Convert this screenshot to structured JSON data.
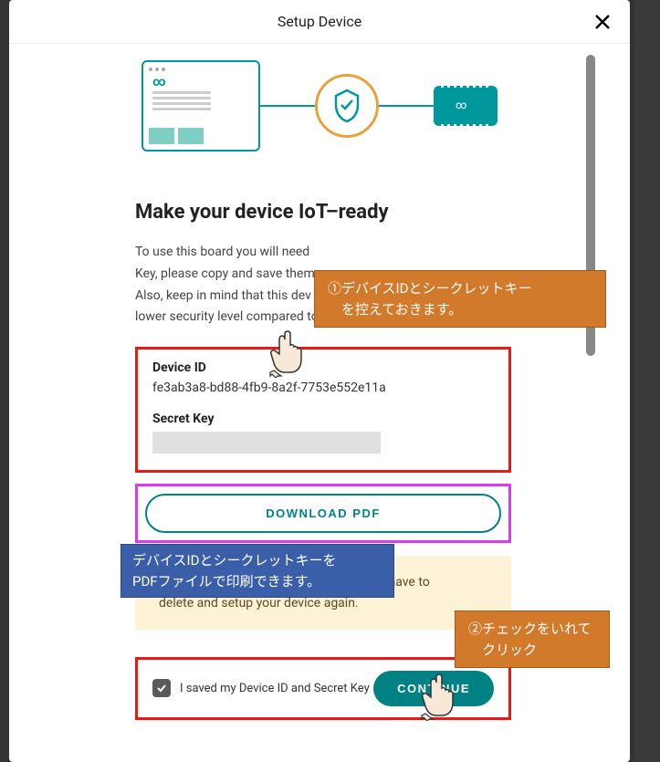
{
  "header": {
    "title": "Setup Device"
  },
  "main": {
    "heading": "Make your device IoT–ready",
    "description_l1": "To use this board you will need",
    "description_l2": "Key, please copy and save them",
    "description_l3": "Also, keep in mind that this dev",
    "description_l4": "lower security level compared to other Arduino devices.",
    "device_id_label": "Device ID",
    "device_id_value": "fe3ab3a8-bd88-4fb9-8a2f-7753e552e11a",
    "secret_key_label": "Secret Key",
    "download_label": "DOWNLOAD PDF",
    "warning_l1": "Please keep it safe, if you lose it you will have to",
    "warning_l2": "delete and setup your device again.",
    "checkbox_label": "I saved my Device ID and Secret Key",
    "continue_label": "CONTINUE"
  },
  "annotations": {
    "a1_l1": "①デバイスIDとシークレットキー",
    "a1_l2": "　を控えておきます。",
    "a2_l1": "デバイスIDとシークレットキーを",
    "a2_l2": "PDFファイルで印刷できます。",
    "a3_l1": "②チェックをいれて",
    "a3_l2": "　クリック"
  }
}
